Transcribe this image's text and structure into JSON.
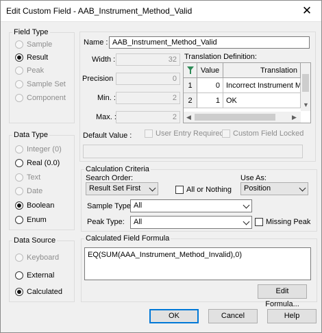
{
  "window": {
    "title": "Edit Custom Field - AAB_Instrument_Method_Valid",
    "close_glyph": "✕"
  },
  "field_type": {
    "legend": "Field Type",
    "options": [
      "Sample",
      "Result",
      "Peak",
      "Sample Set",
      "Component"
    ],
    "selected": "Result"
  },
  "data_type": {
    "legend": "Data Type",
    "options": [
      "Integer (0)",
      "Real (0.0)",
      "Text",
      "Date",
      "Boolean",
      "Enum"
    ],
    "selected": "Boolean"
  },
  "data_source": {
    "legend": "Data Source",
    "options": [
      "Keyboard",
      "External",
      "Calculated"
    ],
    "selected": "Calculated"
  },
  "props": {
    "name_label": "Name :",
    "name_value": "AAB_Instrument_Method_Valid",
    "width_label": "Width :",
    "width_value": "32",
    "precision_label": "Precision :",
    "precision_value": "0",
    "min_label": "Min. :",
    "min_value": "2",
    "max_label": "Max. :",
    "max_value": "2",
    "default_label": "Default Value :",
    "default_value": "",
    "user_entry_required": "User Entry Required",
    "custom_field_locked": "Custom Field Locked"
  },
  "translation": {
    "label": "Translation Definition:",
    "columns": [
      "Value",
      "Translation"
    ],
    "rows": [
      {
        "num": "1",
        "value": "0",
        "translation": "Incorrect Instrument Met"
      },
      {
        "num": "2",
        "value": "1",
        "translation": "OK"
      }
    ]
  },
  "calc": {
    "legend": "Calculation Criteria",
    "search_order_label": "Search Order:",
    "search_order_value": "Result Set First",
    "all_or_nothing": "All or Nothing",
    "use_as_label": "Use As:",
    "use_as_value": "Position",
    "sample_type_label": "Sample Type:",
    "sample_type_value": "All",
    "peak_type_label": "Peak Type:",
    "peak_type_value": "All",
    "missing_peak": "Missing Peak"
  },
  "formula": {
    "legend": "Calculated Field Formula",
    "text": "EQ(SUM(AAA_Instrument_Method_Invalid),0)",
    "edit_button": "Edit Formula..."
  },
  "buttons": {
    "ok": "OK",
    "cancel": "Cancel",
    "help": "Help"
  },
  "colors": {
    "accent": "#0078d7",
    "window_bg": "#f0f0f0",
    "grid_icon": "#2e8b57"
  }
}
